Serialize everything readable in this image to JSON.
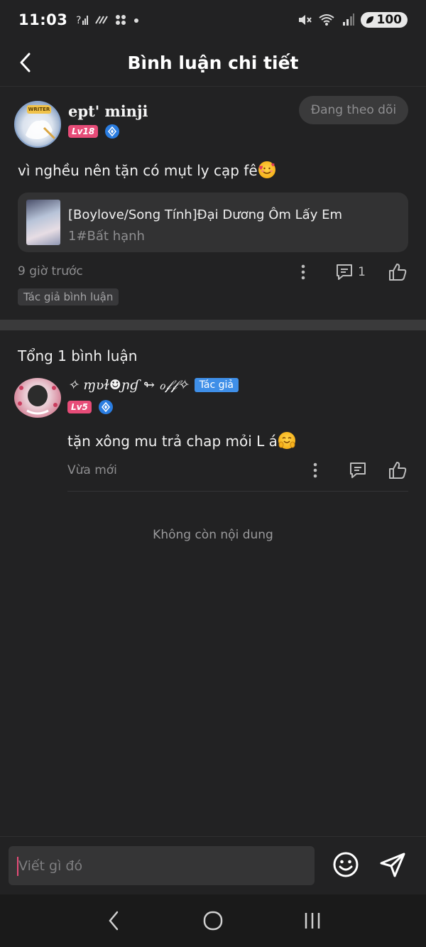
{
  "status_bar": {
    "time": "11:03",
    "battery": "100"
  },
  "header": {
    "title": "Bình luận chi tiết"
  },
  "post": {
    "username": "ept' minji",
    "level": "Lv18",
    "follow_label": "Đang theo dõi",
    "text": "vì nghều nên tặn có mụt ly cạp fê",
    "book": {
      "title": "[Boylove/Song Tính]Đại Dương Ôm Lấy Em",
      "chapter": "1#Bất hạnh"
    },
    "time_ago": "9 giờ trước",
    "reply_count": "1",
    "author_tag": "Tác giả bình luận"
  },
  "comments": {
    "total_label": "Tổng 1 bình luận",
    "items": [
      {
        "username": "✧ ɱʋɫ☻ɲɠ ↬ ℴ𝒻𝒻✧",
        "author_badge": "Tác giả",
        "level": "Lv5",
        "text": "tặn xông mu trả chap mỏi L á",
        "time_ago": "Vừa mới"
      }
    ],
    "end_label": "Không còn nội dung"
  },
  "composer": {
    "placeholder": "Viết gì đó"
  },
  "colors": {
    "background": "#222223",
    "level_badge": "#e74c78",
    "author_badge": "#3f8fe8"
  }
}
